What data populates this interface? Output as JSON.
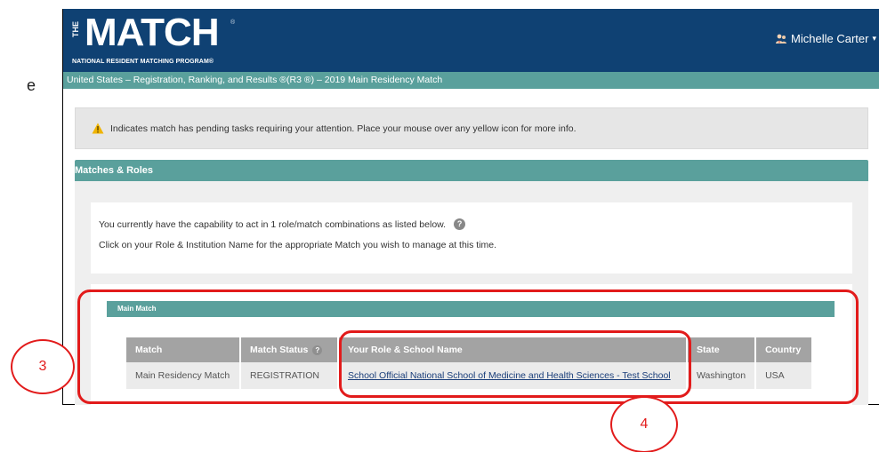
{
  "side_fragment": "e",
  "header": {
    "logo_the": "THE",
    "logo_match": "MATCH",
    "logo_reg": "®",
    "logo_sub": "NATIONAL RESIDENT MATCHING PROGRAM®",
    "user_name": "Michelle Carter",
    "caret": "▾"
  },
  "breadcrumb": "United States  –  Registration, Ranking, and Results ®(R3 ®)  –  2019 Main Residency Match",
  "alert": {
    "text": "Indicates match has pending tasks requiring your attention. Place your mouse over any yellow icon for more info."
  },
  "panel": {
    "title": "Matches & Roles",
    "info_line1": "You currently have the capability to act in 1 role/match combinations as listed below.",
    "info_line2": "Click on your Role & Institution Name for the appropriate Match you wish to manage at this time.",
    "help_glyph": "?"
  },
  "submatch": {
    "title": "Main Match",
    "columns": [
      "Match",
      "Match Status",
      "Your Role & School Name",
      "State",
      "Country"
    ],
    "rows": [
      {
        "match": "Main Residency Match",
        "status": "REGISTRATION",
        "role_school": "School Official National School of Medicine and Health Sciences - Test School",
        "state": "Washington",
        "country": "USA"
      }
    ]
  },
  "annotations": {
    "circle_3": "3",
    "circle_4": "4",
    "accent_color": "#e21b1b"
  },
  "colors": {
    "header_blue": "#0f4173",
    "teal": "#5aa09c",
    "table_header_gray": "#a3a3a3"
  }
}
